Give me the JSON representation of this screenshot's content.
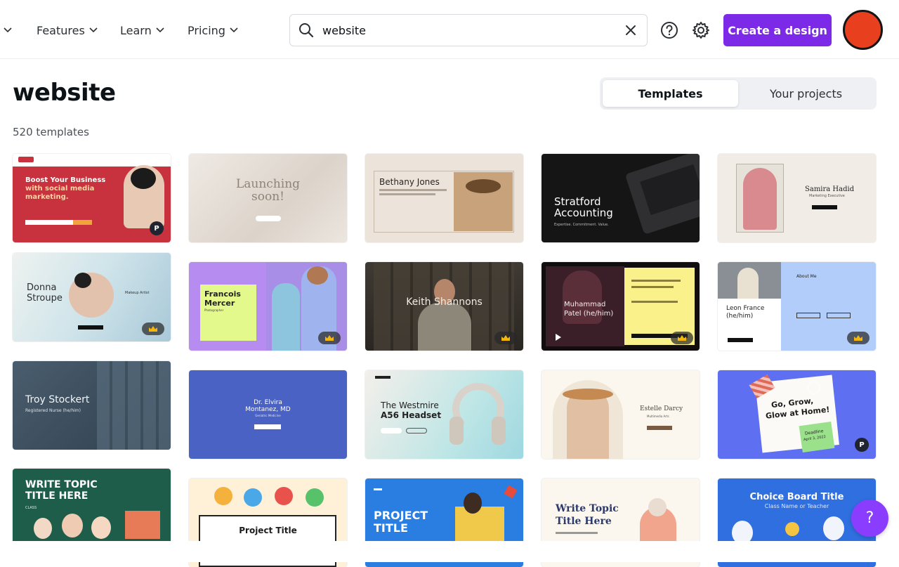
{
  "nav": {
    "items": [
      {
        "label": "Features"
      },
      {
        "label": "Learn"
      },
      {
        "label": "Pricing"
      }
    ]
  },
  "search": {
    "value": "website",
    "placeholder": "Search"
  },
  "header": {
    "cta_label": "Create a design",
    "help_icon": "help-circle-icon",
    "settings_icon": "gear-icon"
  },
  "main": {
    "title": "website",
    "count": "520 templates",
    "tabs": [
      {
        "label": "Templates",
        "active": true
      },
      {
        "label": "Your projects",
        "active": false
      }
    ]
  },
  "templates": [
    {
      "lines": [
        "Boost Your Business",
        "with social media",
        "marketing."
      ]
    },
    {
      "lines": [
        "Launching",
        "soon!"
      ]
    },
    {
      "lines": [
        "Bethany Jones"
      ]
    },
    {
      "lines": [
        "Stratford",
        "Accounting",
        "Expertise. Commitment. Value."
      ]
    },
    {
      "lines": [
        "Samira Hadid",
        "Marketing Executive"
      ]
    },
    {
      "lines": [
        "Donna",
        "Stroupe",
        "Makeup Artist"
      ]
    },
    {
      "lines": [
        "Francois",
        "Mercer",
        "Photographer"
      ]
    },
    {
      "lines": [
        "Keith Shannons"
      ]
    },
    {
      "lines": [
        "Muhammad",
        "Patel (he/him)"
      ]
    },
    {
      "lines": [
        "Leon France",
        "(he/him)",
        "About Me"
      ]
    },
    {
      "lines": [
        "Troy Stockert",
        "Registered Nurse (he/him)"
      ]
    },
    {
      "lines": [
        "Dr. Elvira",
        "Montanez, MD",
        "Geriatric Medicine"
      ]
    },
    {
      "lines": [
        "The Westmire",
        "A56 Headset"
      ]
    },
    {
      "lines": [
        "Estelle Darcy",
        "Multimedia Arts"
      ]
    },
    {
      "lines": [
        "Go, Grow,",
        "Glow at Home!",
        "Deadline",
        "April 3, 2022"
      ]
    },
    {
      "lines": [
        "WRITE TOPIC",
        "TITLE HERE",
        "CLASS"
      ]
    },
    {
      "lines": [
        "Project Title"
      ]
    },
    {
      "lines": [
        "PROJECT",
        "TITLE"
      ]
    },
    {
      "lines": [
        "Write Topic",
        "Title Here"
      ]
    },
    {
      "lines": [
        "Choice Board Title",
        "Class Name or Teacher"
      ]
    }
  ],
  "colors": {
    "brand_purple": "#7d2ae8",
    "avatar_red": "#e8401f",
    "help_fab": "#8b3dff"
  },
  "help_fab_label": "?"
}
